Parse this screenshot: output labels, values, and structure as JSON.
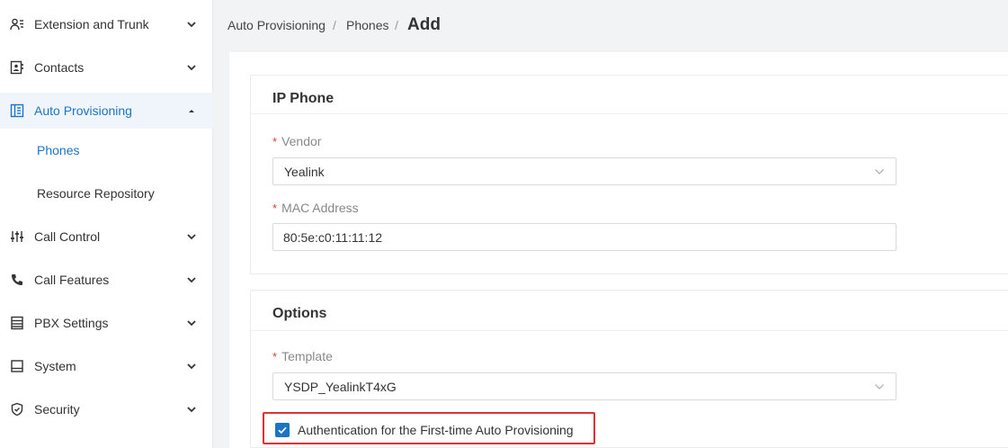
{
  "sidebar": {
    "items": [
      {
        "label": "Extension and Trunk",
        "icon": "user-list-icon"
      },
      {
        "label": "Contacts",
        "icon": "contacts-icon"
      },
      {
        "label": "Auto Provisioning",
        "icon": "provisioning-icon"
      },
      {
        "label": "Call Control",
        "icon": "sliders-icon"
      },
      {
        "label": "Call Features",
        "icon": "phone-icon"
      },
      {
        "label": "PBX Settings",
        "icon": "server-icon"
      },
      {
        "label": "System",
        "icon": "monitor-icon"
      },
      {
        "label": "Security",
        "icon": "shield-icon"
      }
    ],
    "sub_items": [
      {
        "label": "Phones"
      },
      {
        "label": "Resource Repository"
      }
    ]
  },
  "breadcrumb": {
    "root": "Auto Provisioning",
    "sep1": "/",
    "parent": "Phones",
    "sep2": "/",
    "current": "Add"
  },
  "ip_phone": {
    "title": "IP Phone",
    "vendor_label": "Vendor",
    "vendor_value": "Yealink",
    "mac_label": "MAC Address",
    "mac_value": "80:5e:c0:11:11:12"
  },
  "options": {
    "title": "Options",
    "template_label": "Template",
    "template_value": "YSDP_YealinkT4xG",
    "auth_label": "Authentication for the First-time Auto Provisioning",
    "auth_checked": true
  },
  "required_marker": "*",
  "colors": {
    "accent": "#1a75c8",
    "active_bg": "#f0f5fb",
    "required": "#e53935",
    "highlight_border": "#e03030"
  }
}
